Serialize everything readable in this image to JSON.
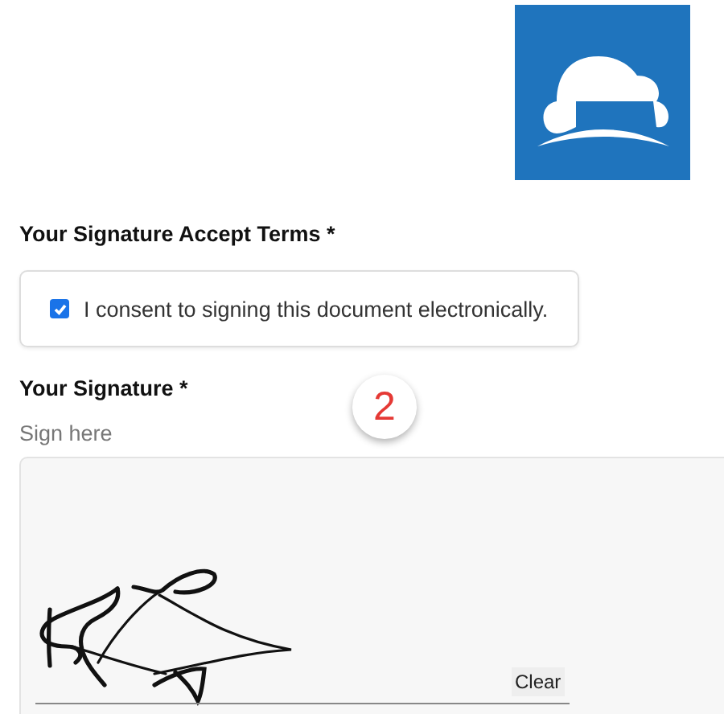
{
  "terms": {
    "heading": "Your Signature Accept Terms *",
    "consent": {
      "label": "I consent to signing this document electronically.",
      "checked": true
    }
  },
  "signature": {
    "heading": "Your Signature *",
    "hint": "Sign here",
    "clear_button": "Clear"
  },
  "step_badge": {
    "number": "2"
  }
}
